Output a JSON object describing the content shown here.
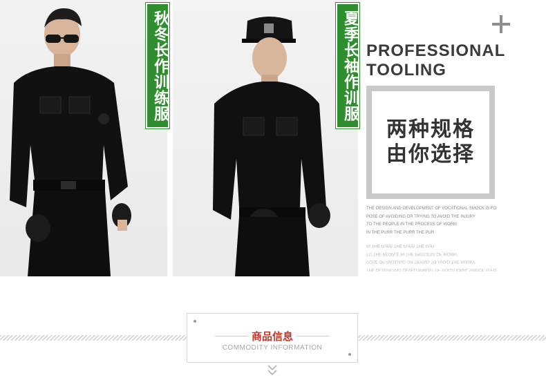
{
  "products": {
    "left": {
      "tag": "秋冬长作训练服"
    },
    "right": {
      "tag": "夏季长袖作训服"
    }
  },
  "promo": {
    "title_line1": "PROFESSIONAL",
    "title_line2": "TOOLING",
    "spec_line1": "两种规格",
    "spec_line2": "由你选择",
    "description_lines": [
      "THE DESIGN AND DEVELOPMENT OF VOCATIONAL SMOCK IS FO",
      "POSE OF AVOIDING OR TRYING TO AVOID THE INJURY",
      "TO THE PEOPLE IN THE PROCESS OF WORK!",
      "IN THE PURR THE PURR THE PUR"
    ]
  },
  "section": {
    "title": "商品信息",
    "subtitle": "COMMODITY INFORMATION"
  },
  "colors": {
    "tag_green": "#2f8f2f",
    "accent_red": "#c0392b",
    "text_dark": "#3a3a3a"
  },
  "icons": [
    "plus-icon",
    "chevron-down-icon"
  ]
}
